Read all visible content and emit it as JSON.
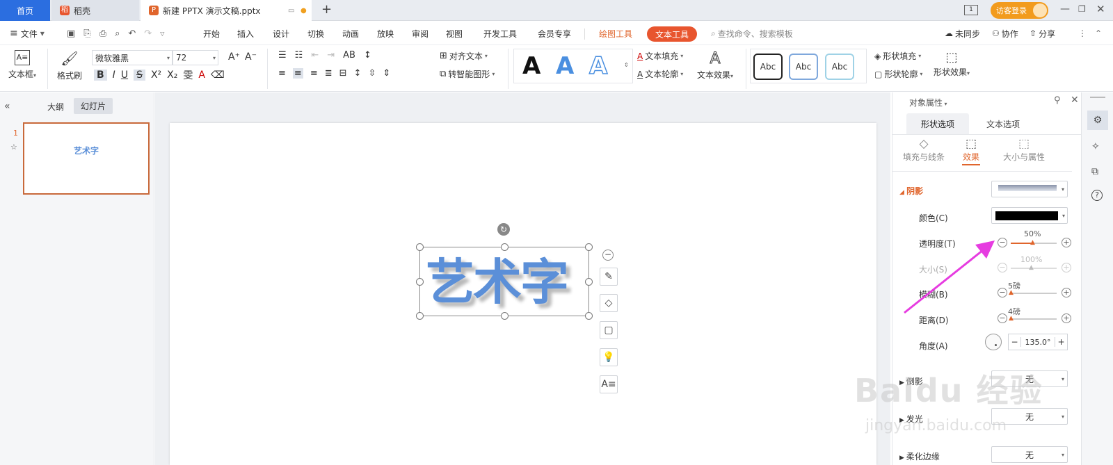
{
  "tabs": {
    "home": "首页",
    "daoke": "稻壳",
    "doc": "新建 PPTX 演示文稿.pptx",
    "add": "+"
  },
  "titlebar": {
    "page_indicator": "1",
    "login": "访客登录"
  },
  "menubar": {
    "file": "文件",
    "items": [
      "开始",
      "插入",
      "设计",
      "切换",
      "动画",
      "放映",
      "审阅",
      "视图",
      "开发工具",
      "会员专享"
    ],
    "drawing_tools": "绘图工具",
    "text_tools": "文本工具",
    "search_placeholder": "查找命令、搜索模板",
    "unsynced": "未同步",
    "collab": "协作",
    "share": "分享"
  },
  "ribbon": {
    "textbox": "文本框",
    "format_painter": "格式刷",
    "font_name": "微软雅黑",
    "font_size": "72",
    "align_text": "对齐文本",
    "smart_shape": "转智能图形",
    "wordart_letter": "A",
    "text_fill": "文本填充",
    "text_outline": "文本轮廓",
    "text_effect": "文本效果",
    "style_abc": [
      "Abc",
      "Abc",
      "Abc"
    ],
    "shape_fill": "形状填充",
    "shape_outline": "形状轮廓",
    "shape_effect": "形状效果"
  },
  "leftpanel": {
    "outline_tab": "大纲",
    "slides_tab": "幻灯片",
    "slide_number": "1",
    "thumb_text": "艺术字"
  },
  "slide": {
    "art_text": "艺术字"
  },
  "rightpanel": {
    "title": "对象属性",
    "tab_shape": "形状选项",
    "tab_text": "文本选项",
    "sub_fill": "填充与线条",
    "sub_effect": "效果",
    "sub_size": "大小与属性",
    "shadow": "阴影",
    "color": "颜色(C)",
    "transparency": "透明度(T)",
    "transparency_val": "50%",
    "transparency_level": 0.5,
    "size": "大小(S)",
    "size_val": "100%",
    "blur": "模糊(B)",
    "blur_val": "5磅",
    "distance": "距离(D)",
    "distance_val": "4磅",
    "angle": "角度(A)",
    "angle_val": "135.0°",
    "reflection": "倒影",
    "glow": "发光",
    "soft_edge": "柔化边缘",
    "none": "无"
  },
  "watermark": {
    "line1": "Baidu 经验",
    "line2": "jingyan.baidu.com"
  },
  "colors": {
    "accent_blue": "#2b6ee0",
    "orange": "#e0652c",
    "art_text": "#5b8fd8",
    "arrow": "#e63ce0"
  }
}
